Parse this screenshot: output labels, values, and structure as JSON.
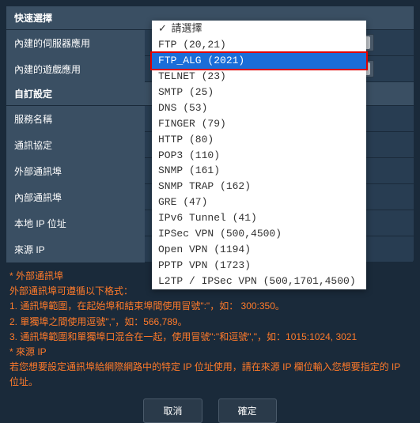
{
  "sections": {
    "quick": "快速選擇",
    "custom": "自訂設定"
  },
  "labels": {
    "server_app": "內建的伺服器應用",
    "game_app": "內建的遊戲應用",
    "service_name": "服務名稱",
    "protocol": "通訊協定",
    "external_port": "外部通訊埠",
    "internal_port": "內部通訊埠",
    "local_ip": "本地 IP 位址",
    "source_ip": "來源 IP"
  },
  "dropdown": {
    "items": [
      {
        "label": "請選擇",
        "checked": true
      },
      {
        "label": "FTP (20,21)"
      },
      {
        "label": "FTP_ALG (2021)",
        "selected": true
      },
      {
        "label": "TELNET (23)"
      },
      {
        "label": "SMTP (25)"
      },
      {
        "label": "DNS (53)"
      },
      {
        "label": "FINGER (79)"
      },
      {
        "label": "HTTP (80)"
      },
      {
        "label": "POP3 (110)"
      },
      {
        "label": "SNMP (161)"
      },
      {
        "label": "SNMP TRAP (162)"
      },
      {
        "label": "GRE (47)"
      },
      {
        "label": "IPv6 Tunnel (41)"
      },
      {
        "label": "IPSec VPN (500,4500)"
      },
      {
        "label": "Open VPN (1194)"
      },
      {
        "label": "PPTP VPN (1723)"
      },
      {
        "label": "L2TP / IPSec VPN (500,1701,4500)"
      }
    ]
  },
  "hints": {
    "ext_title": "* 外部通訊埠",
    "ext_sub": "外部通訊埠可遵循以下格式：",
    "h1": "1. 通訊埠範圍，在起始埠和結束埠間使用冒號\":\"，如： 300:350。",
    "h2": "2. 單獨埠之間使用逗號\",\"，如：566,789。",
    "h3": "3. 通訊埠範圍和單獨埠口混合在一起，使用冒號\":\"和逗號\",\"，如：1015:1024, 3021",
    "src_title": "* 來源 IP",
    "src_text": "若您想要設定通訊埠給網際網路中的特定 IP 位址使用，請在來源 IP 欄位輸入您想要指定的 IP 位址。"
  },
  "buttons": {
    "cancel": "取消",
    "ok": "確定"
  }
}
